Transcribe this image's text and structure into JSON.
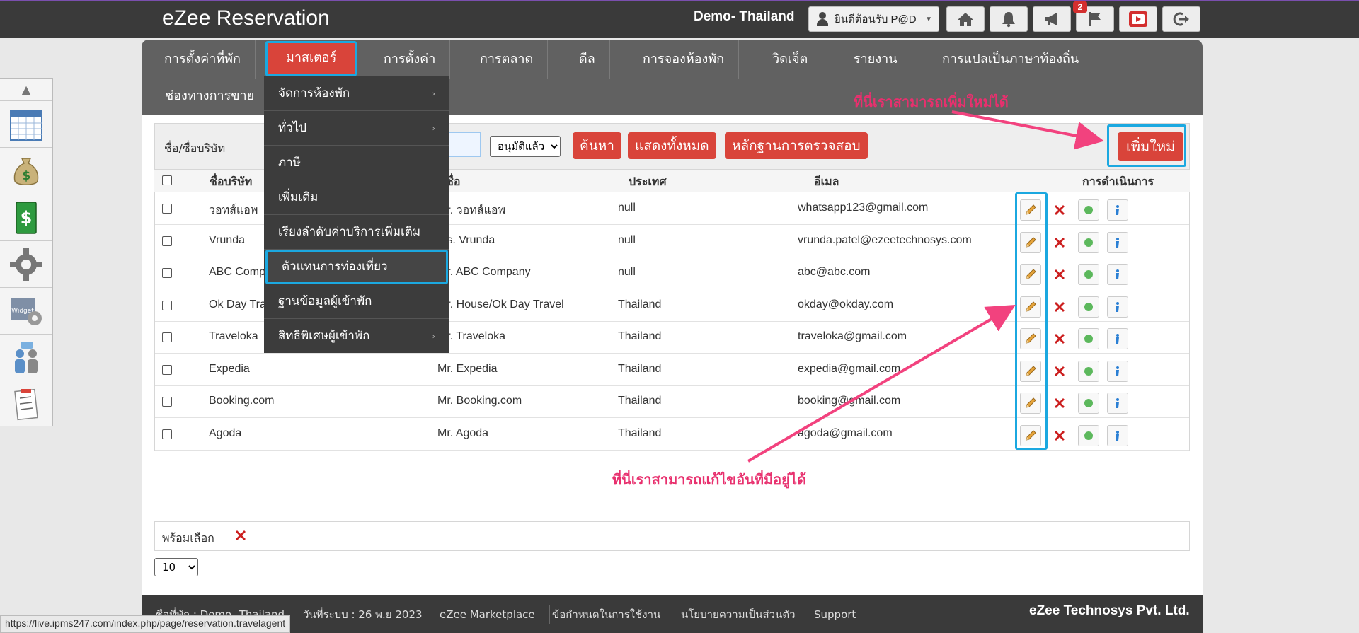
{
  "app": {
    "title": "eZee Reservation",
    "property": "Demo- Thailand",
    "user": "ยินดีต้อนรับ P@D",
    "notification_count": "2"
  },
  "nav": {
    "items": [
      "การตั้งค่าที่พัก",
      "มาสเตอร์",
      "การตั้งค่า",
      "การตลาด",
      "ดีล",
      "การจองห้องพัก",
      "วิดเจ็ต",
      "รายงาน",
      "การแปลเป็นภาษาท้องถิ่น"
    ],
    "second_row": "ช่องทางการขาย"
  },
  "dropdown": {
    "items": [
      "จัดการห้องพัก",
      "ทั่วไป",
      "ภาษี",
      "เพิ่มเติม",
      "เรียงลำดับค่าบริการเพิ่มเติม",
      "ตัวแทนการท่องเที่ยว",
      "ฐานข้อมูลผู้เข้าพัก",
      "สิทธิพิเศษผู้เข้าพัก"
    ],
    "submenu_marker": "›"
  },
  "filter": {
    "label": "ชื่อ/ชื่อบริษัท",
    "status": "อนุมัติแล้ว",
    "search": "ค้นหา",
    "show_all": "แสดงทั้งหมด",
    "audit": "หลักฐานการตรวจสอบ",
    "add_new": "เพิ่มใหม่"
  },
  "table": {
    "headers": {
      "company": "ชื่อบริษัท",
      "name": "ชื่อ",
      "country": "ประเทศ",
      "email": "อีเมล",
      "actions": "การดำเนินการ"
    },
    "rows": [
      {
        "company": "วอทส์แอพ",
        "name": "Mr. วอทส์แอพ",
        "country": "null",
        "email": "whatsapp123@gmail.com"
      },
      {
        "company": "Vrunda",
        "name": "Ms. Vrunda",
        "country": "null",
        "email": "vrunda.patel@ezeetechnosys.com"
      },
      {
        "company": "ABC Company",
        "name": "Mr. ABC Company",
        "country": "null",
        "email": "abc@abc.com"
      },
      {
        "company": "Ok Day Travel",
        "name": "Mr. House/Ok Day Travel",
        "country": "Thailand",
        "email": "okday@okday.com"
      },
      {
        "company": "Traveloka",
        "name": "Mr. Traveloka",
        "country": "Thailand",
        "email": "traveloka@gmail.com"
      },
      {
        "company": "Expedia",
        "name": "Mr. Expedia",
        "country": "Thailand",
        "email": "expedia@gmail.com"
      },
      {
        "company": "Booking.com",
        "name": "Mr. Booking.com",
        "country": "Thailand",
        "email": "booking@gmail.com"
      },
      {
        "company": "Agoda",
        "name": "Mr. Agoda",
        "country": "Thailand",
        "email": "agoda@gmail.com"
      }
    ]
  },
  "annotations": {
    "add_new": "ที่นี่เราสามารถเพิ่มใหม่ได้",
    "edit": "ที่นี่เราสามารถแก้ไขอันที่มีอยู่ได้"
  },
  "bulk": {
    "label": "พร้อมเลือก",
    "page_size": "10"
  },
  "footer": {
    "property": "ชื่อที่พัก : Demo- Thailand",
    "system_date": "วันที่ระบบ : 26 พ.ย 2023",
    "marketplace": "eZee Marketplace",
    "terms": "ข้อกำหนดในการใช้งาน",
    "privacy": "นโยบายความเป็นส่วนตัว",
    "support": "Support",
    "company": "eZee Technosys Pvt. Ltd."
  },
  "status_url": "https://live.ipms247.com/index.php/page/reservation.travelagent",
  "colors": {
    "accent_red": "#d9443a",
    "highlight_blue": "#1ba8e0",
    "annotation_pink": "#e8306e",
    "nav_gray": "#616161"
  },
  "icons": [
    "home-icon",
    "bell-icon",
    "megaphone-icon",
    "flag-icon",
    "youtube-icon",
    "logout-icon",
    "calendar-icon",
    "money-bag-icon",
    "dollar-icon",
    "gear-icon",
    "widget-icon",
    "users-icon",
    "notes-icon",
    "pencil-icon",
    "delete-icon",
    "status-dot-icon",
    "info-icon"
  ]
}
